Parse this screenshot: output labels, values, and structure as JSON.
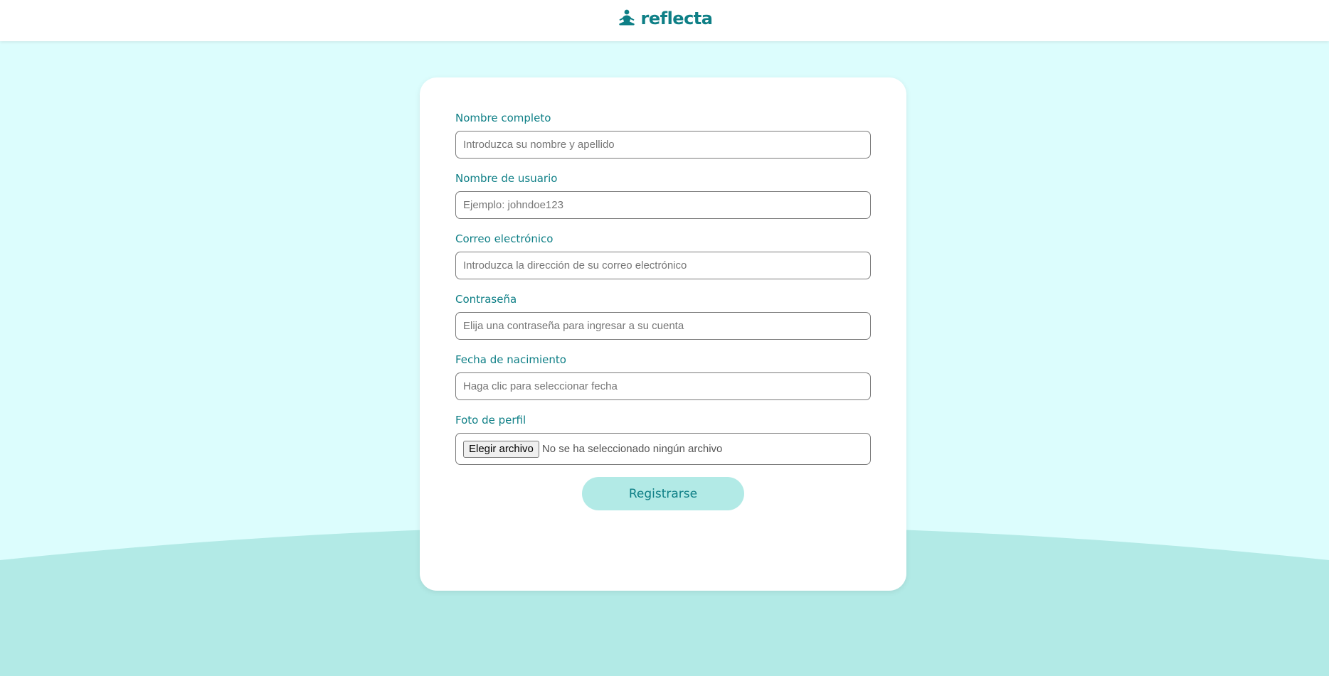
{
  "brand": {
    "name": "reflecta",
    "icon": "meditation-person-icon",
    "color": "#0e7f86"
  },
  "colors": {
    "background": "#dcfdfd",
    "wave": "#b2eae6",
    "accent": "#0e7f86",
    "button": "#b2eae6"
  },
  "form": {
    "fields": [
      {
        "label": "Nombre completo",
        "placeholder": "Introduzca su nombre y apellido",
        "value": ""
      },
      {
        "label": "Nombre de usuario",
        "placeholder": "Ejemplo: johndoe123",
        "value": ""
      },
      {
        "label": "Correo electrónico",
        "placeholder": "Introduzca la dirección de su correo electrónico",
        "value": ""
      },
      {
        "label": "Contraseña",
        "placeholder": "Elija una contraseña para ingresar a su cuenta",
        "value": ""
      },
      {
        "label": "Fecha de nacimiento",
        "placeholder": "Haga clic para seleccionar fecha",
        "value": ""
      }
    ],
    "photo": {
      "label": "Foto de perfil",
      "button_label": "Elegir archivo",
      "status": "No se ha seleccionado ningún archivo"
    },
    "submit_label": "Registrarse"
  }
}
